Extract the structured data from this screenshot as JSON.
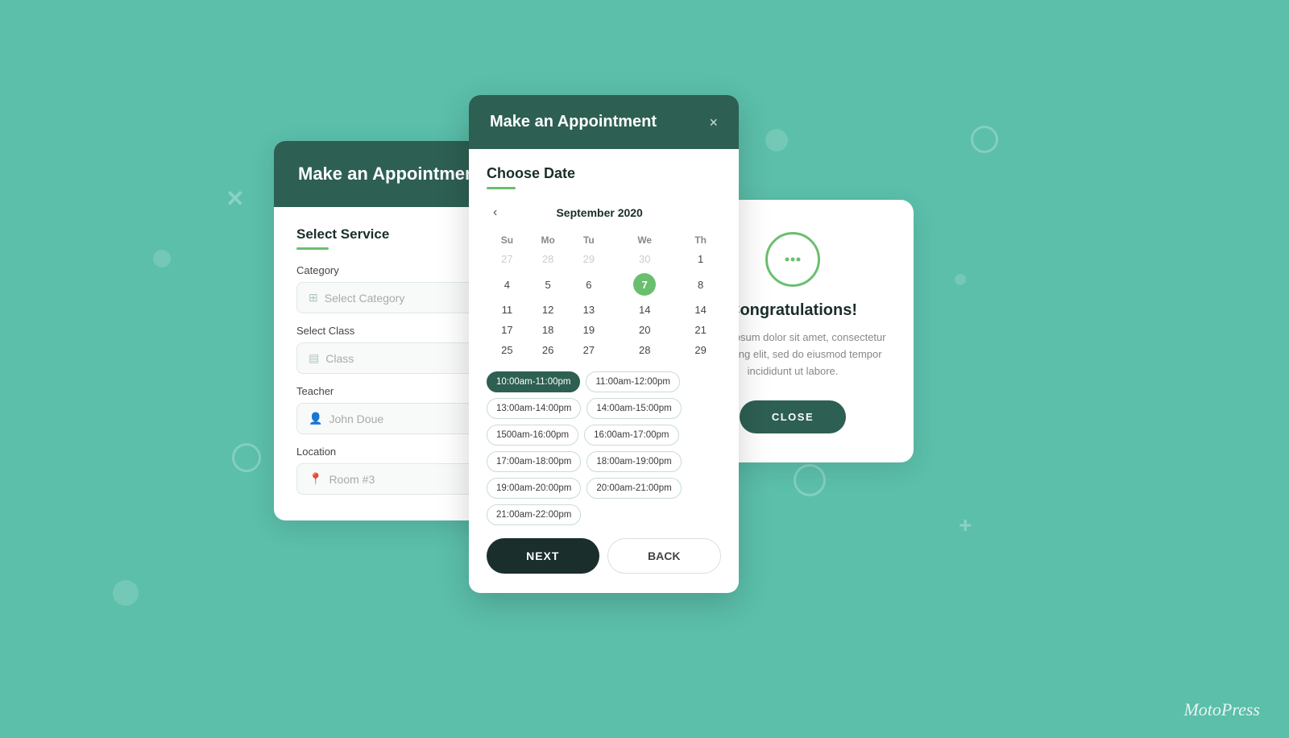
{
  "background": {
    "color": "#5bbfaa"
  },
  "card_service": {
    "header": "Make an Appointment",
    "section_title": "Select Service",
    "fields": {
      "category_label": "Category",
      "category_placeholder": "Select Category",
      "class_label": "Select Class",
      "class_placeholder": "Class",
      "teacher_label": "Teacher",
      "teacher_placeholder": "John Doue",
      "location_label": "Location",
      "location_placeholder": "Room #3"
    }
  },
  "card_calendar": {
    "header": "Make an Appointment",
    "close_label": "×",
    "section_title": "Choose Date",
    "calendar": {
      "month": "September 2020",
      "days_of_week": [
        "Su",
        "Mo",
        "Tu",
        "We",
        "Th"
      ],
      "weeks": [
        [
          "27",
          "28",
          "29",
          "30",
          "1"
        ],
        [
          "4",
          "5",
          "6",
          "7",
          "8"
        ],
        [
          "11",
          "12",
          "13",
          "14",
          "14"
        ],
        [
          "17",
          "18",
          "19",
          "20",
          "21"
        ],
        [
          "25",
          "26",
          "27",
          "28",
          "29"
        ]
      ],
      "selected_day": "7",
      "other_month_days": [
        "27",
        "28",
        "29",
        "30"
      ]
    },
    "time_slots": [
      {
        "label": "10:00am-11:00pm",
        "active": true
      },
      {
        "label": "11:00am-12:00pm",
        "active": false
      },
      {
        "label": "13:00am-14:00pm",
        "active": false
      },
      {
        "label": "14:00am-15:00pm",
        "active": false
      },
      {
        "label": "1500am-16:00pm",
        "active": false
      },
      {
        "label": "16:00am-17:00pm",
        "active": false
      },
      {
        "label": "17:00am-18:00pm",
        "active": false
      },
      {
        "label": "18:00am-19:00pm",
        "active": false
      },
      {
        "label": "19:00am-20:00pm",
        "active": false
      },
      {
        "label": "20:00am-21:00pm",
        "active": false
      },
      {
        "label": "21:00am-22:00pm",
        "active": false
      }
    ],
    "buttons": {
      "next": "NEXT",
      "back": "BACK"
    }
  },
  "card_congrats": {
    "title": "Congratulations!",
    "body_text": "Lorem ipsum dolor sit amet, consectetur adipiscing elit, sed do eiusmod tempor incididunt ut labore.",
    "close_button": "CLOSE"
  },
  "brand": "MotoPress"
}
